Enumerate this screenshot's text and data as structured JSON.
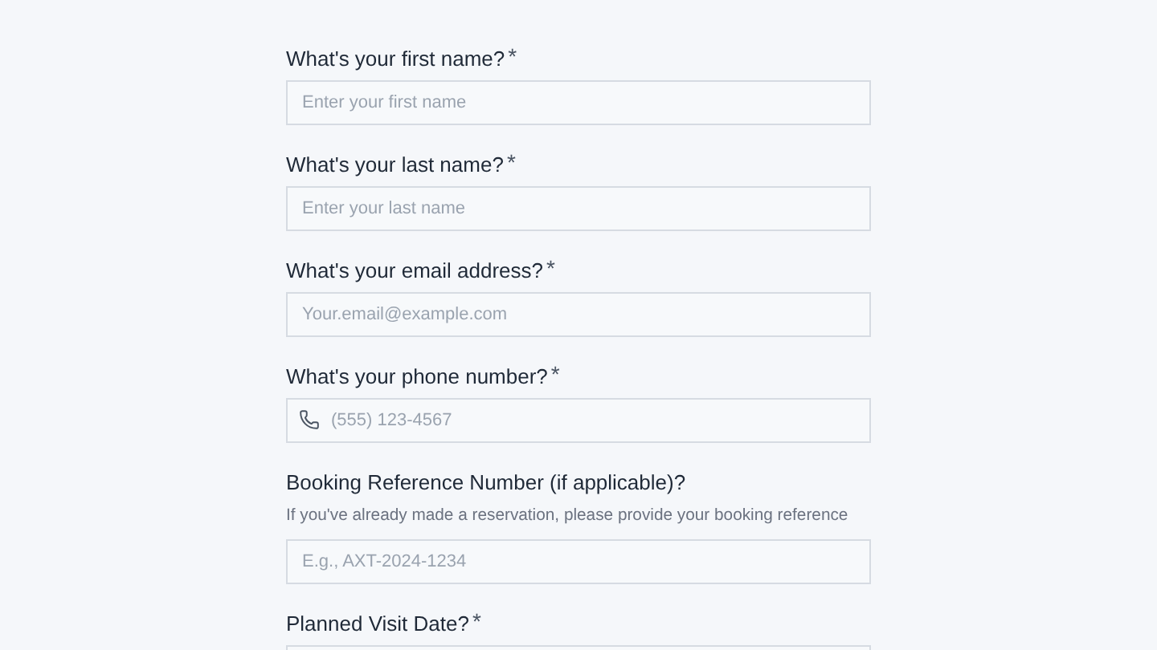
{
  "fields": [
    {
      "kind": "text",
      "label": "What's your first name?",
      "required_mark": "*",
      "placeholder": "Enter your first name"
    },
    {
      "kind": "text",
      "label": "What's your last name?",
      "required_mark": "*",
      "placeholder": "Enter your last name"
    },
    {
      "kind": "text",
      "label": "What's your email address?",
      "required_mark": "*",
      "placeholder": "Your.email@example.com"
    },
    {
      "kind": "phone",
      "label": "What's your phone number?",
      "required_mark": "*",
      "placeholder": "(555) 123-4567"
    },
    {
      "kind": "text",
      "label": "Booking Reference Number (if applicable)?",
      "hint": "If you've already made a reservation, please provide your booking reference",
      "placeholder": "E.g., AXT-2024-1234"
    },
    {
      "kind": "text",
      "label": "Planned Visit Date?",
      "required_mark": "*"
    }
  ]
}
